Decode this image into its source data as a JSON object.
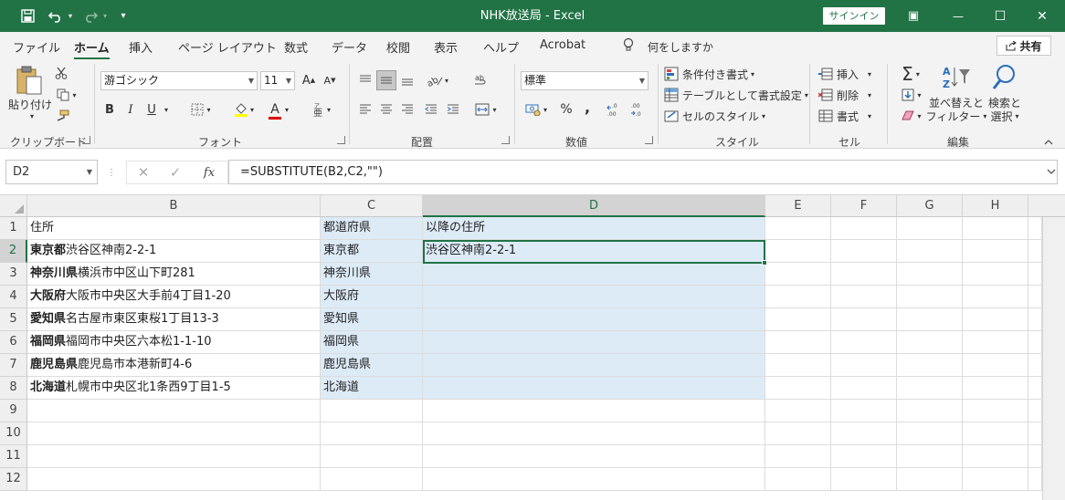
{
  "window": {
    "title": "NHK放送局  -  Excel",
    "signin_label": "サインイン",
    "qat": {
      "save_icon": "save-icon",
      "undo_icon": "undo-icon",
      "redo_icon": "redo-icon",
      "customize": "▾"
    },
    "controls": {
      "ribbon_display": "▣",
      "minimize": "—",
      "maximize": "☐",
      "close": "✕"
    }
  },
  "menu": {
    "tabs": [
      "ファイル",
      "ホーム",
      "挿入",
      "ページ レイアウト",
      "数式",
      "データ",
      "校閲",
      "表示",
      "ヘルプ",
      "Acrobat"
    ],
    "active_tab": "ホーム",
    "tell_me": "何をしますか",
    "share_label": "共有"
  },
  "ribbon": {
    "clipboard": {
      "paste_label": "貼り付け",
      "group_label": "クリップボード"
    },
    "font": {
      "font_name": "游ゴシック",
      "font_size": "11",
      "bold": "B",
      "italic": "I",
      "underline": "U",
      "font_color": "A",
      "group_label": "フォント"
    },
    "alignment": {
      "group_label": "配置"
    },
    "number": {
      "format": "標準",
      "percent": "%",
      "comma": ",",
      "group_label": "数値"
    },
    "styles": {
      "conditional": "条件付き書式",
      "format_table": "テーブルとして書式設定",
      "cell_styles": "セルのスタイル",
      "group_label": "スタイル"
    },
    "cells": {
      "insert": "挿入",
      "delete": "削除",
      "format": "書式",
      "group_label": "セル"
    },
    "editing": {
      "sort_filter_1": "並べ替えと",
      "sort_filter_2": "フィルター",
      "find_select_1": "検索と",
      "find_select_2": "選択",
      "group_label": "編集"
    }
  },
  "formula_bar": {
    "name_box": "D2",
    "fx": "fx",
    "formula": "=SUBSTITUTE(B2,C2,\"\")"
  },
  "sheet": {
    "columns": [
      "B",
      "C",
      "D",
      "E",
      "F",
      "G",
      "H"
    ],
    "selected_column": "D",
    "rows": [
      "1",
      "2",
      "3",
      "4",
      "5",
      "6",
      "7",
      "8",
      "9",
      "10",
      "11",
      "12"
    ],
    "selected_row": "2",
    "header_row": {
      "b": "住所",
      "c": "都道府県",
      "d": "以降の住所"
    },
    "data": [
      {
        "b_bold": "東京都",
        "b_rest": "渋谷区神南2-2-1",
        "c": "東京都",
        "d": "渋谷区神南2-2-1"
      },
      {
        "b_bold": "神奈川県",
        "b_rest": "横浜市中区山下町281",
        "c": "神奈川県",
        "d": ""
      },
      {
        "b_bold": "大阪府",
        "b_rest": "大阪市中央区大手前4丁目1-20",
        "c": "大阪府",
        "d": ""
      },
      {
        "b_bold": "愛知県",
        "b_rest": "名古屋市東区東桜1丁目13-3",
        "c": "愛知県",
        "d": ""
      },
      {
        "b_bold": "福岡県",
        "b_rest": "福岡市中央区六本松1-1-10",
        "c": "福岡県",
        "d": ""
      },
      {
        "b_bold": "鹿児島県",
        "b_rest": "鹿児島市本港新町4-6",
        "c": "鹿児島県",
        "d": ""
      },
      {
        "b_bold": "北海道",
        "b_rest": "札幌市中央区北1条西9丁目1-5",
        "c": "北海道",
        "d": ""
      }
    ]
  },
  "colors": {
    "excel_green": "#217346",
    "selection_fill": "#ddebf7",
    "font_color_bar": "#e00000"
  }
}
